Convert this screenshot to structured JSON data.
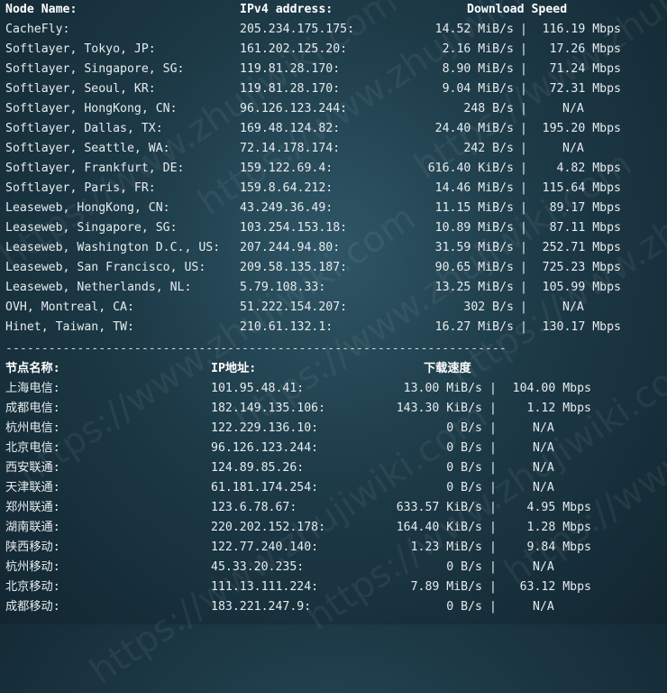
{
  "intl": {
    "headers": {
      "node": "Node Name:",
      "ip": "IPv4 address:",
      "speed": "Download Speed"
    },
    "rows": [
      {
        "node": "CacheFly:",
        "ip": "205.234.175.175:",
        "mib": "14.52 MiB/s",
        "mbps": "116.19 Mbps"
      },
      {
        "node": "Softlayer, Tokyo, JP:",
        "ip": "161.202.125.20:",
        "mib": "2.16 MiB/s",
        "mbps": "17.26 Mbps"
      },
      {
        "node": "Softlayer, Singapore, SG:",
        "ip": "119.81.28.170:",
        "mib": "8.90 MiB/s",
        "mbps": "71.24 Mbps"
      },
      {
        "node": "Softlayer, Seoul, KR:",
        "ip": "119.81.28.170:",
        "mib": "9.04 MiB/s",
        "mbps": "72.31 Mbps"
      },
      {
        "node": "Softlayer, HongKong, CN:",
        "ip": "96.126.123.244:",
        "mib": "248 B/s",
        "mbps": "N/A"
      },
      {
        "node": "Softlayer, Dallas, TX:",
        "ip": "169.48.124.82:",
        "mib": "24.40 MiB/s",
        "mbps": "195.20 Mbps"
      },
      {
        "node": "Softlayer, Seattle, WA:",
        "ip": "72.14.178.174:",
        "mib": "242 B/s",
        "mbps": "N/A"
      },
      {
        "node": "Softlayer, Frankfurt, DE:",
        "ip": "159.122.69.4:",
        "mib": "616.40 KiB/s",
        "mbps": "4.82 Mbps"
      },
      {
        "node": "Softlayer, Paris, FR:",
        "ip": "159.8.64.212:",
        "mib": "14.46 MiB/s",
        "mbps": "115.64 Mbps"
      },
      {
        "node": "Leaseweb, HongKong, CN:",
        "ip": "43.249.36.49:",
        "mib": "11.15 MiB/s",
        "mbps": "89.17 Mbps"
      },
      {
        "node": "Leaseweb, Singapore, SG:",
        "ip": "103.254.153.18:",
        "mib": "10.89 MiB/s",
        "mbps": "87.11 Mbps"
      },
      {
        "node": "Leaseweb, Washington D.C., US:",
        "ip": "207.244.94.80:",
        "mib": "31.59 MiB/s",
        "mbps": "252.71 Mbps"
      },
      {
        "node": "Leaseweb, San Francisco, US:",
        "ip": "209.58.135.187:",
        "mib": "90.65 MiB/s",
        "mbps": "725.23 Mbps"
      },
      {
        "node": "Leaseweb, Netherlands, NL:",
        "ip": "5.79.108.33:",
        "mib": "13.25 MiB/s",
        "mbps": "105.99 Mbps"
      },
      {
        "node": "OVH, Montreal, CA:",
        "ip": "51.222.154.207:",
        "mib": "302 B/s",
        "mbps": "N/A"
      },
      {
        "node": "Hinet, Taiwan, TW:",
        "ip": "210.61.132.1:",
        "mib": "16.27 MiB/s",
        "mbps": "130.17 Mbps"
      }
    ]
  },
  "divider": "----------------------------------------------------------------------",
  "cn": {
    "headers": {
      "node": "节点名称:",
      "ip": "IP地址:",
      "speed": "下载速度"
    },
    "rows": [
      {
        "node": "上海电信:",
        "ip": "101.95.48.41:",
        "mib": "13.00 MiB/s",
        "mbps": "104.00 Mbps"
      },
      {
        "node": "成都电信:",
        "ip": "182.149.135.106:",
        "mib": "143.30 KiB/s",
        "mbps": "1.12 Mbps"
      },
      {
        "node": "杭州电信:",
        "ip": "122.229.136.10:",
        "mib": "0 B/s",
        "mbps": "N/A"
      },
      {
        "node": "北京电信:",
        "ip": "96.126.123.244:",
        "mib": "0 B/s",
        "mbps": "N/A"
      },
      {
        "node": "西安联通:",
        "ip": "124.89.85.26:",
        "mib": "0 B/s",
        "mbps": "N/A"
      },
      {
        "node": "天津联通:",
        "ip": "61.181.174.254:",
        "mib": "0 B/s",
        "mbps": "N/A"
      },
      {
        "node": "郑州联通:",
        "ip": "123.6.78.67:",
        "mib": "633.57 KiB/s",
        "mbps": "4.95 Mbps"
      },
      {
        "node": "湖南联通:",
        "ip": "220.202.152.178:",
        "mib": "164.40 KiB/s",
        "mbps": "1.28 Mbps"
      },
      {
        "node": "陕西移动:",
        "ip": "122.77.240.140:",
        "mib": "1.23 MiB/s",
        "mbps": "9.84 Mbps"
      },
      {
        "node": "杭州移动:",
        "ip": "45.33.20.235:",
        "mib": "0 B/s",
        "mbps": "N/A"
      },
      {
        "node": "北京移动:",
        "ip": "111.13.111.224:",
        "mib": "7.89 MiB/s",
        "mbps": "63.12 Mbps"
      },
      {
        "node": "成都移动:",
        "ip": "183.221.247.9:",
        "mib": "0 B/s",
        "mbps": "N/A"
      }
    ]
  },
  "separator": "|",
  "watermark": "https://www.zhujiwiki.com"
}
